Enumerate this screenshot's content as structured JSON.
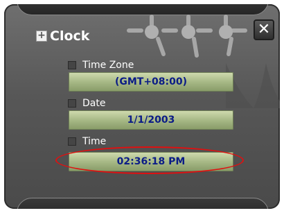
{
  "dialog": {
    "title": "Clock",
    "title_icon": "plus-square-icon",
    "close_label": "✕",
    "close_icon": "close-icon"
  },
  "fields": {
    "timezone": {
      "label": "Time Zone",
      "value": "(GMT+08:00)"
    },
    "date": {
      "label": "Date",
      "value": "1/1/2003"
    },
    "time": {
      "label": "Time",
      "value": "02:36:18 PM"
    }
  },
  "colors": {
    "value_text": "#0b1c86",
    "value_box": "#a7b986",
    "highlight_ellipse": "#e01010",
    "background": "#575757"
  }
}
